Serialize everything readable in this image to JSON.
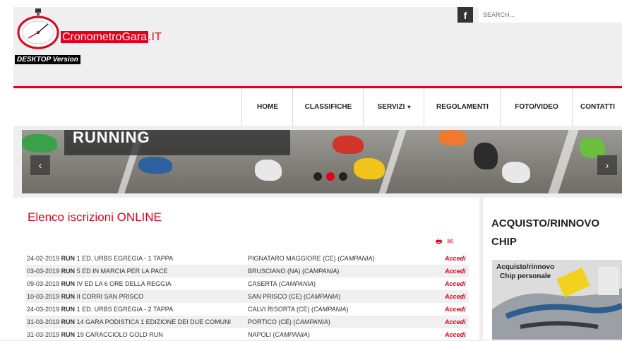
{
  "brand": {
    "name_highlight": "CronometroGara",
    "name_rest": ".IT",
    "version": "DESKTOP Version"
  },
  "header": {
    "facebook_label": "f",
    "search_placeholder": "SEARCH..."
  },
  "nav": [
    {
      "label": "HOME",
      "dropdown": false
    },
    {
      "label": "CLASSIFICHE",
      "dropdown": false
    },
    {
      "label": "SERVIZI",
      "dropdown": true
    },
    {
      "label": "REGOLAMENTI",
      "dropdown": false
    },
    {
      "label": "FOTO/VIDEO",
      "dropdown": false
    },
    {
      "label": "CONTATTI",
      "dropdown": false
    }
  ],
  "slider": {
    "caption": "RUNNING",
    "prev": "‹",
    "next": "›",
    "active_dot": 1
  },
  "main": {
    "title": "Elenco iscrizioni ONLINE",
    "rows": [
      {
        "date": "24-02-2019",
        "type": "RUN",
        "event": "1 ED. URBS EGREGIA - 1 TAPPA",
        "place": "PIGNATARO MAGGIORE (CE)",
        "region": "CAMPANIA",
        "action": "Accedi"
      },
      {
        "date": "03-03-2019",
        "type": "RUN",
        "event": "5 ED IN MARCIA PER LA PACE",
        "place": "BRUSCIANO (NA)",
        "region": "CAMPANIA",
        "action": "Accedi"
      },
      {
        "date": "09-03-2019",
        "type": "RUN",
        "event": "IV ED LA 6 ORE DELLA REGGIA",
        "place": "CASERTA",
        "region": "CAMPANIA",
        "action": "Accedi"
      },
      {
        "date": "10-03-2019",
        "type": "RUN",
        "event": "II CORRI SAN PRISCO",
        "place": "SAN PRISCO (CE)",
        "region": "CAMPANIA",
        "action": "Accedi"
      },
      {
        "date": "24-03-2019",
        "type": "RUN",
        "event": "1 ED. URBS EGREGIA - 2 TAPPA",
        "place": "CALVI RISORTA (CE)",
        "region": "CAMPANIA",
        "action": "Accedi"
      },
      {
        "date": "31-03-2019",
        "type": "RUN",
        "event": "14 GARA PODISTICA 1 EDIZIONE DEI DUE COMUNI",
        "place": "PORTICO (CE)",
        "region": "CAMPANIA",
        "action": "Accedi"
      },
      {
        "date": "31-03-2019",
        "type": "RUN",
        "event": "19 CARACCIOLO GOLD RUN",
        "place": "NAPOLI",
        "region": "CAMPANIA",
        "action": "Accedi"
      }
    ]
  },
  "sidebar": {
    "title": "ACQUISTO/RINNOVO CHIP",
    "image_caption_1": "Acquisto/rinnovo",
    "image_caption_2": "Chip personale"
  },
  "colors": {
    "accent": "#e2001a",
    "background": "#efefef"
  }
}
